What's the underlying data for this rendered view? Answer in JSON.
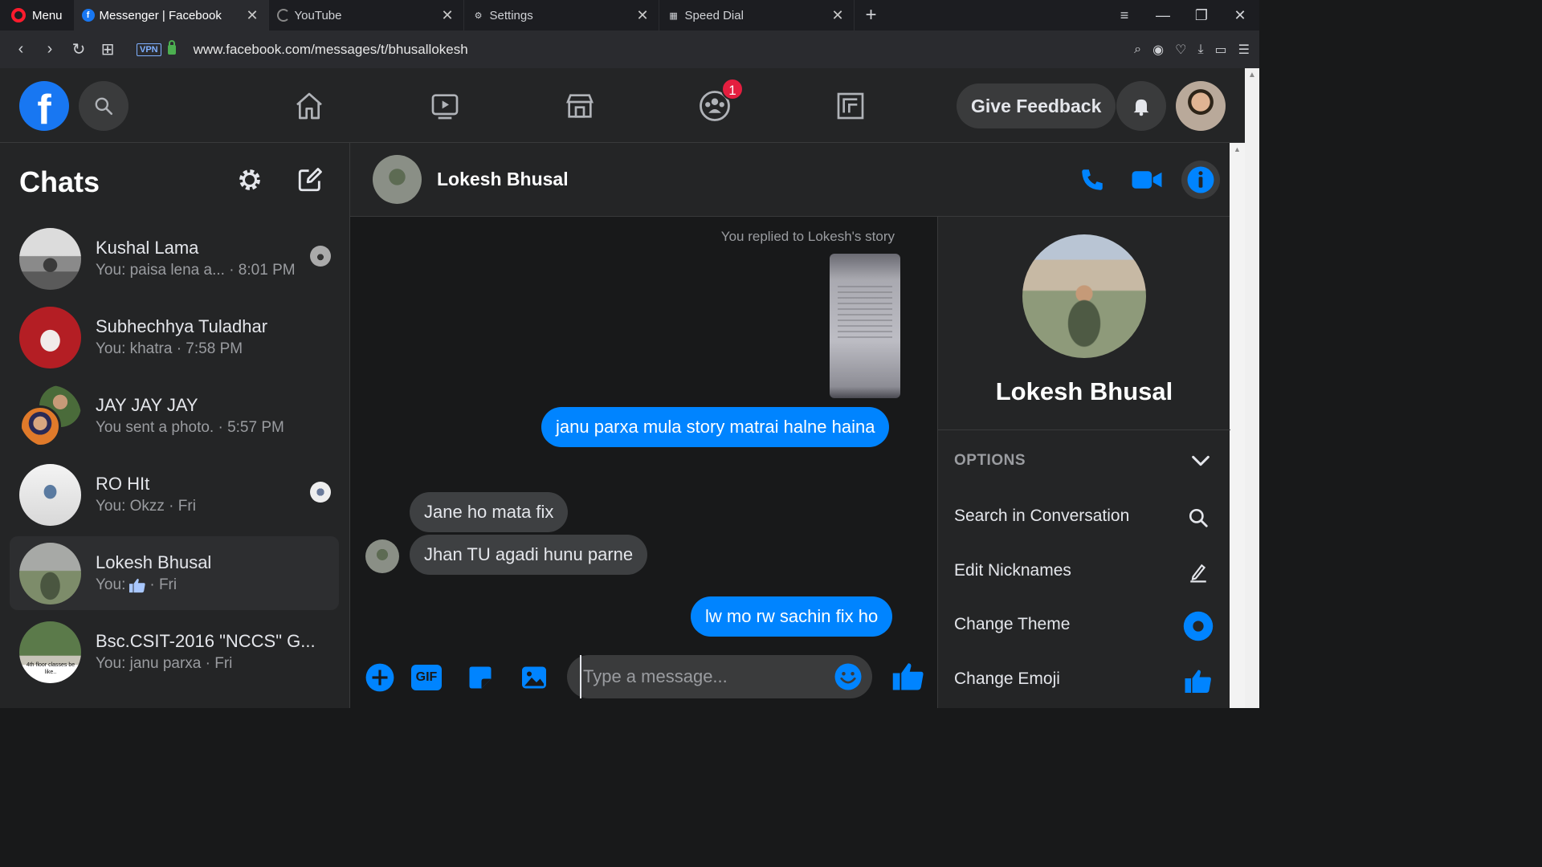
{
  "browser": {
    "menu_label": "Menu",
    "tabs": [
      {
        "title": "Messenger | Facebook",
        "icon": "facebook-icon",
        "active": true
      },
      {
        "title": "YouTube",
        "icon": "loading-icon",
        "active": false
      },
      {
        "title": "Settings",
        "icon": "gear-icon",
        "active": false
      },
      {
        "title": "Speed Dial",
        "icon": "grid-icon",
        "active": false
      }
    ],
    "vpn_label": "VPN",
    "url": "www.facebook.com/messages/t/bhusallokesh"
  },
  "header": {
    "logo_letter": "f",
    "nav": [
      "home-icon",
      "watch-icon",
      "marketplace-icon",
      "groups-icon",
      "gaming-icon"
    ],
    "groups_badge": "1",
    "give_feedback": "Give Feedback"
  },
  "sidebar": {
    "title": "Chats",
    "chats": [
      {
        "name": "Kushal Lama",
        "preview": "You: paisa lena a... · 8:01 PM"
      },
      {
        "name": "Subhechhya Tuladhar",
        "preview": "You: khatra · 7:58 PM"
      },
      {
        "name": "JAY JAY JAY",
        "preview": "You sent a photo. · 5:57 PM"
      },
      {
        "name": "RO HIt",
        "preview": "You: Okzz · Fri"
      },
      {
        "name": "Lokesh Bhusal",
        "preview_prefix": "You:",
        "preview_suffix": "· Fri"
      },
      {
        "name": "Bsc.CSIT-2016 \"NCCS\" G...",
        "preview": "You: janu parxa · Fri",
        "avatar_caption": "4th floor classes be like.."
      }
    ]
  },
  "conversation": {
    "name": "Lokesh Bhusal",
    "story_note": "You replied to Lokesh's story",
    "messages": [
      {
        "dir": "out",
        "text": "janu parxa mula story matrai halne haina"
      },
      {
        "dir": "in",
        "text": "Jane ho mata fix"
      },
      {
        "dir": "in",
        "text": "Jhan TU agadi hunu parne"
      },
      {
        "dir": "out",
        "text": "lw mo rw sachin fix ho"
      }
    ],
    "composer_placeholder": "Type a message...",
    "gif_label": "GIF"
  },
  "info_panel": {
    "name": "Lokesh Bhusal",
    "options_title": "OPTIONS",
    "options": [
      {
        "label": "Search in Conversation",
        "icon": "search-icon"
      },
      {
        "label": "Edit Nicknames",
        "icon": "pencil-icon"
      },
      {
        "label": "Change Theme",
        "icon": "theme-dot-icon"
      },
      {
        "label": "Change Emoji",
        "icon": "thumbs-up-icon"
      }
    ]
  },
  "colors": {
    "accent": "#0084ff",
    "fb_blue": "#1877f2",
    "badge_red": "#e41e3f",
    "background": "#18191a",
    "panel": "#242526"
  }
}
